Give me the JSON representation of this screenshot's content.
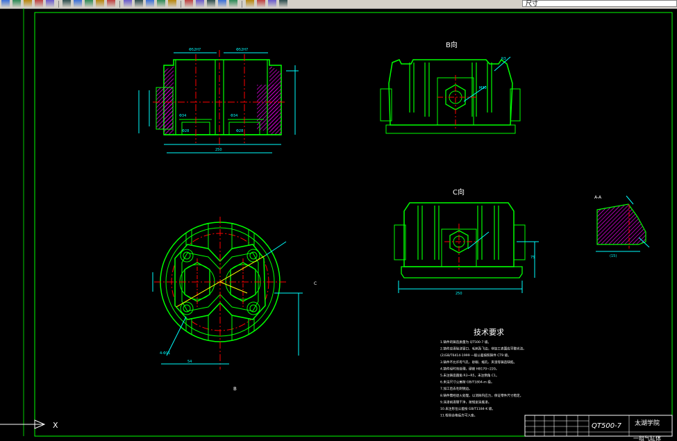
{
  "toolbar": {
    "layer_value": "尺寸",
    "buttons": [
      "open-icon",
      "save-icon",
      "print-icon",
      "preview-icon",
      "publish-icon",
      "cut-icon",
      "copy-icon",
      "paste-icon",
      "match-icon",
      "undo-icon",
      "redo-icon",
      "pan-icon",
      "zoom-realtime-icon",
      "zoom-window-icon",
      "zoom-previous-icon",
      "properties-icon",
      "design-center-icon",
      "tool-palettes-icon",
      "sheet-set-icon",
      "markup-icon",
      "calc-icon",
      "layer-manager-icon",
      "layer-state-icon",
      "layer-prev-icon"
    ]
  },
  "drawing": {
    "view_b_label": "B向",
    "view_c_label": "C向",
    "section_label": "A-A",
    "tech_req_title": "技术要求",
    "tech_req_lines": [
      "1.铸件的铸造质量为 QT500-7 级。",
      "2.铸件应清除浇冒口、毛刺及飞边，非加工表面应平整光洁。",
      "(2)GB/T6414-1999 一般公差按照铸件 CT9 级。",
      "3.铸件不允许有气孔、砂眼、缩孔、夹渣等铸造缺陷。",
      "4.铸件经时效处理，硬度 HB170~220。",
      "5.未注铸造圆角 R3~R5，未注倒角 C1。",
      "6.未注尺寸公差按 GB/T1804-m 级。",
      "7.加工后去毛刺锐边。",
      "8.铸件需经退火处理，以消除内应力，保证零件尺寸稳定。",
      "9.涂漆前清理干净，按规定涂底漆。",
      "10.未注形位公差按 GB/T1184-K 级。",
      "11.检验合格后方可入库。"
    ],
    "title_block": {
      "material": "QT500-7",
      "school": "太湖学院",
      "part_name": "一组气缸体"
    }
  },
  "colors": {
    "background": "#000000",
    "outline": "#00ff00",
    "center_line": "#ff0000",
    "dimension": "#00ffff",
    "hatch": "#ff00ff",
    "text": "#ffffff",
    "highlight": "#ffff00"
  }
}
